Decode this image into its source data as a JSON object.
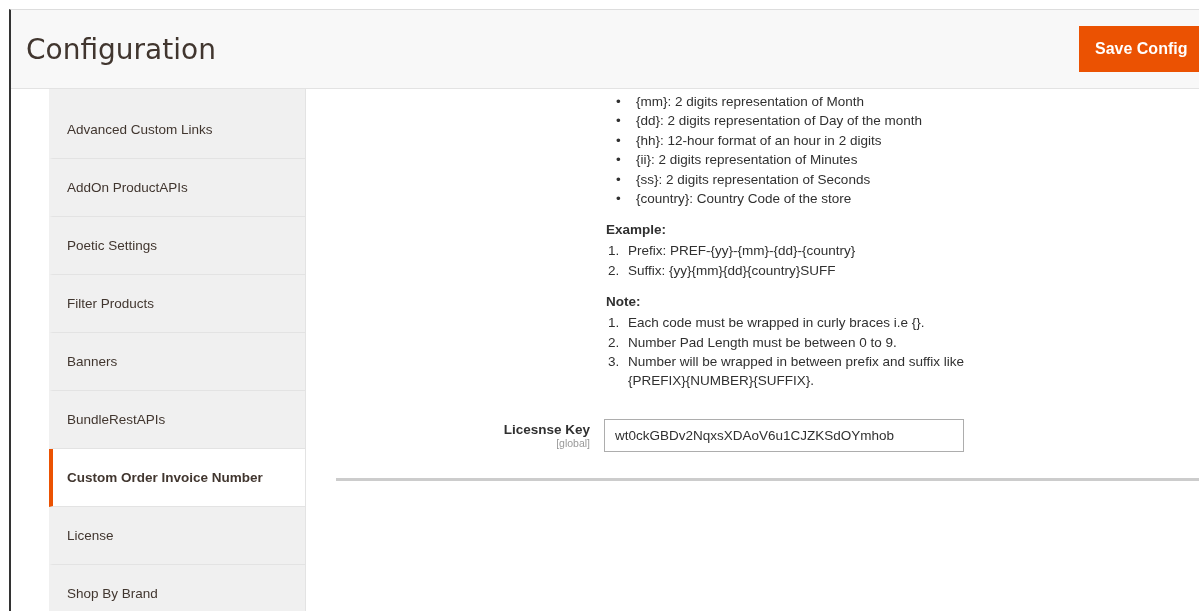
{
  "header": {
    "title": "Configuration",
    "save_button": "Save Config"
  },
  "sidebar": {
    "items": [
      {
        "label": "Advanced Custom Links",
        "selected": false
      },
      {
        "label": "AddOn ProductAPIs",
        "selected": false
      },
      {
        "label": "Poetic Settings",
        "selected": false
      },
      {
        "label": "Filter Products",
        "selected": false
      },
      {
        "label": "Banners",
        "selected": false
      },
      {
        "label": "BundleRestAPIs",
        "selected": false
      },
      {
        "label": "Custom Order Invoice Number",
        "selected": true
      },
      {
        "label": "License",
        "selected": false
      },
      {
        "label": "Shop By Brand",
        "selected": false
      }
    ]
  },
  "help": {
    "codes": [
      {
        "marker": "•",
        "text": "{mm}: 2 digits representation of Month"
      },
      {
        "marker": "•",
        "text": "{dd}: 2 digits representation of Day of the month"
      },
      {
        "marker": "•",
        "text": "{hh}: 12-hour format of an hour in 2 digits"
      },
      {
        "marker": "•",
        "text": "{ii}: 2 digits representation of Minutes"
      },
      {
        "marker": "•",
        "text": "{ss}: 2 digits representation of Seconds"
      },
      {
        "marker": "•",
        "text": "{country}: Country Code of the store"
      }
    ],
    "example_heading": "Example:",
    "examples": [
      {
        "marker": "1.",
        "text": "Prefix: PREF-{yy}-{mm}-{dd}-{country}"
      },
      {
        "marker": "2.",
        "text": "Suffix: {yy}{mm}{dd}{country}SUFF"
      }
    ],
    "note_heading": "Note:",
    "notes": [
      {
        "marker": "1.",
        "text": "Each code must be wrapped in curly braces i.e {}."
      },
      {
        "marker": "2.",
        "text": "Number Pad Length must be between 0 to 9."
      },
      {
        "marker": "3.",
        "text": "Number will be wrapped in between prefix and suffix like {PREFIX}{NUMBER}{SUFFIX}."
      }
    ]
  },
  "license": {
    "label": "Licesnse Key",
    "scope": "[global]",
    "value": "wt0ckGBDv2NqxsXDAoV6u1CJZKSdOYmhob"
  }
}
